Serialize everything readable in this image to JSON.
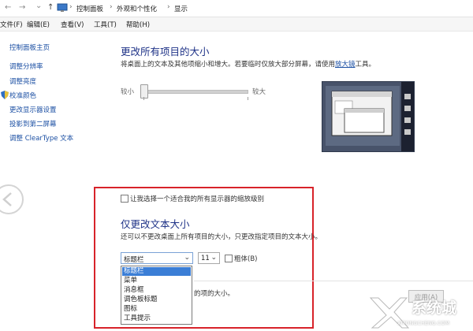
{
  "address_bar": {
    "nav_back": "←",
    "nav_forward": "→",
    "nav_dropdown": "⌄",
    "nav_up": "↑",
    "crumbs": [
      "控制面板",
      "外观和个性化",
      "显示"
    ],
    "separator": "›"
  },
  "menu_bar": {
    "items": [
      "文件(F)",
      "编辑(E)",
      "查看(V)",
      "工具(T)",
      "帮助(H)"
    ]
  },
  "sidebar": {
    "home": "控制面板主页",
    "items": [
      "调整分辨率",
      "调整亮度",
      "校准颜色",
      "更改显示器设置",
      "投影到第二屏幕",
      "调整 ClearType 文本"
    ]
  },
  "main": {
    "title": "更改所有项目的大小",
    "description_prefix": "将桌面上的文本及其他项缩小和增大。若要临时仅放大部分屏幕，请使用",
    "magnifier_link": "放大镜",
    "description_suffix": "工具。",
    "slider": {
      "min_label": "较小",
      "max_label": "较大",
      "level": 0
    }
  },
  "scaling_section": {
    "checkbox_label": "让我选择一个适合我的所有显示器的缩放级别",
    "checkbox_checked": false,
    "title": "仅更改文本大小",
    "description": "还可以不更改桌面上所有项目的大小，只更改指定项目的文本大小。",
    "item_select_value": "标题栏",
    "item_options": [
      "标题栏",
      "菜单",
      "消息框",
      "调色板标题",
      "图标",
      "工具提示"
    ],
    "size_select_value": "11",
    "bold_label": "粗体(B)",
    "bold_checked": false,
    "partial_text": "的项的大小。"
  },
  "footer": {
    "apply_label": "应用(A)"
  },
  "watermark": {
    "brand": "系统城",
    "url": "XITONGCHENG.COM"
  },
  "colors": {
    "title_blue": "#1e3287",
    "link_blue": "#1b4fa3",
    "highlight": "#3b7ed6",
    "red_frame": "#d8232a"
  }
}
